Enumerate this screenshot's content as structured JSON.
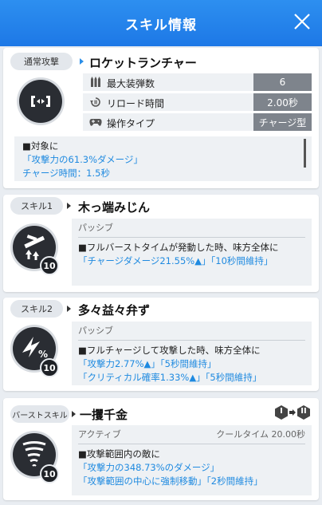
{
  "header": {
    "title": "スキル情報"
  },
  "weapon": {
    "tag": "通常攻撃",
    "name": "ロケットランチャー",
    "stats": [
      {
        "icon": "ammo-icon",
        "label": "最大装弾数",
        "value": "6"
      },
      {
        "icon": "reload-icon",
        "label": "リロード時間",
        "value": "2.00秒"
      },
      {
        "icon": "controller-icon",
        "label": "操作タイプ",
        "value": "チャージ型"
      }
    ],
    "desc_line1": "■対象に",
    "desc_line2": "「攻撃力の61.3%ダメージ」",
    "desc_line3": "チャージ時間：1.5秒"
  },
  "skill1": {
    "tag": "スキル1",
    "name": "木っ端みじん",
    "type": "パッシブ",
    "level": "10",
    "line1": "■フルバーストタイムが発動した時、味方全体に",
    "line2": "「チャージダメージ21.55%▲」「10秒間維持」"
  },
  "skill2": {
    "tag": "スキル2",
    "name": "多々益々弁ず",
    "type": "パッシブ",
    "level": "10",
    "line1": "■フルチャージして攻撃した時、味方全体に",
    "line2": "「攻撃力2.77%▲」「5秒間維持」",
    "line3": "「クリティカル確率1.33%▲」「5秒間維持」"
  },
  "burst": {
    "tag": "バーストスキル",
    "name": "一攫千金",
    "type": "アクティブ",
    "cooldown": "クールタイム 20.00秒",
    "level": "10",
    "stage_from": "I",
    "stage_to": "II",
    "line1": "■攻撃範囲内の敵に",
    "line2": "「攻撃力の348.73%のダメージ」",
    "line3": "「攻撃範囲の中心に強制移動」「2秒間維持」"
  }
}
